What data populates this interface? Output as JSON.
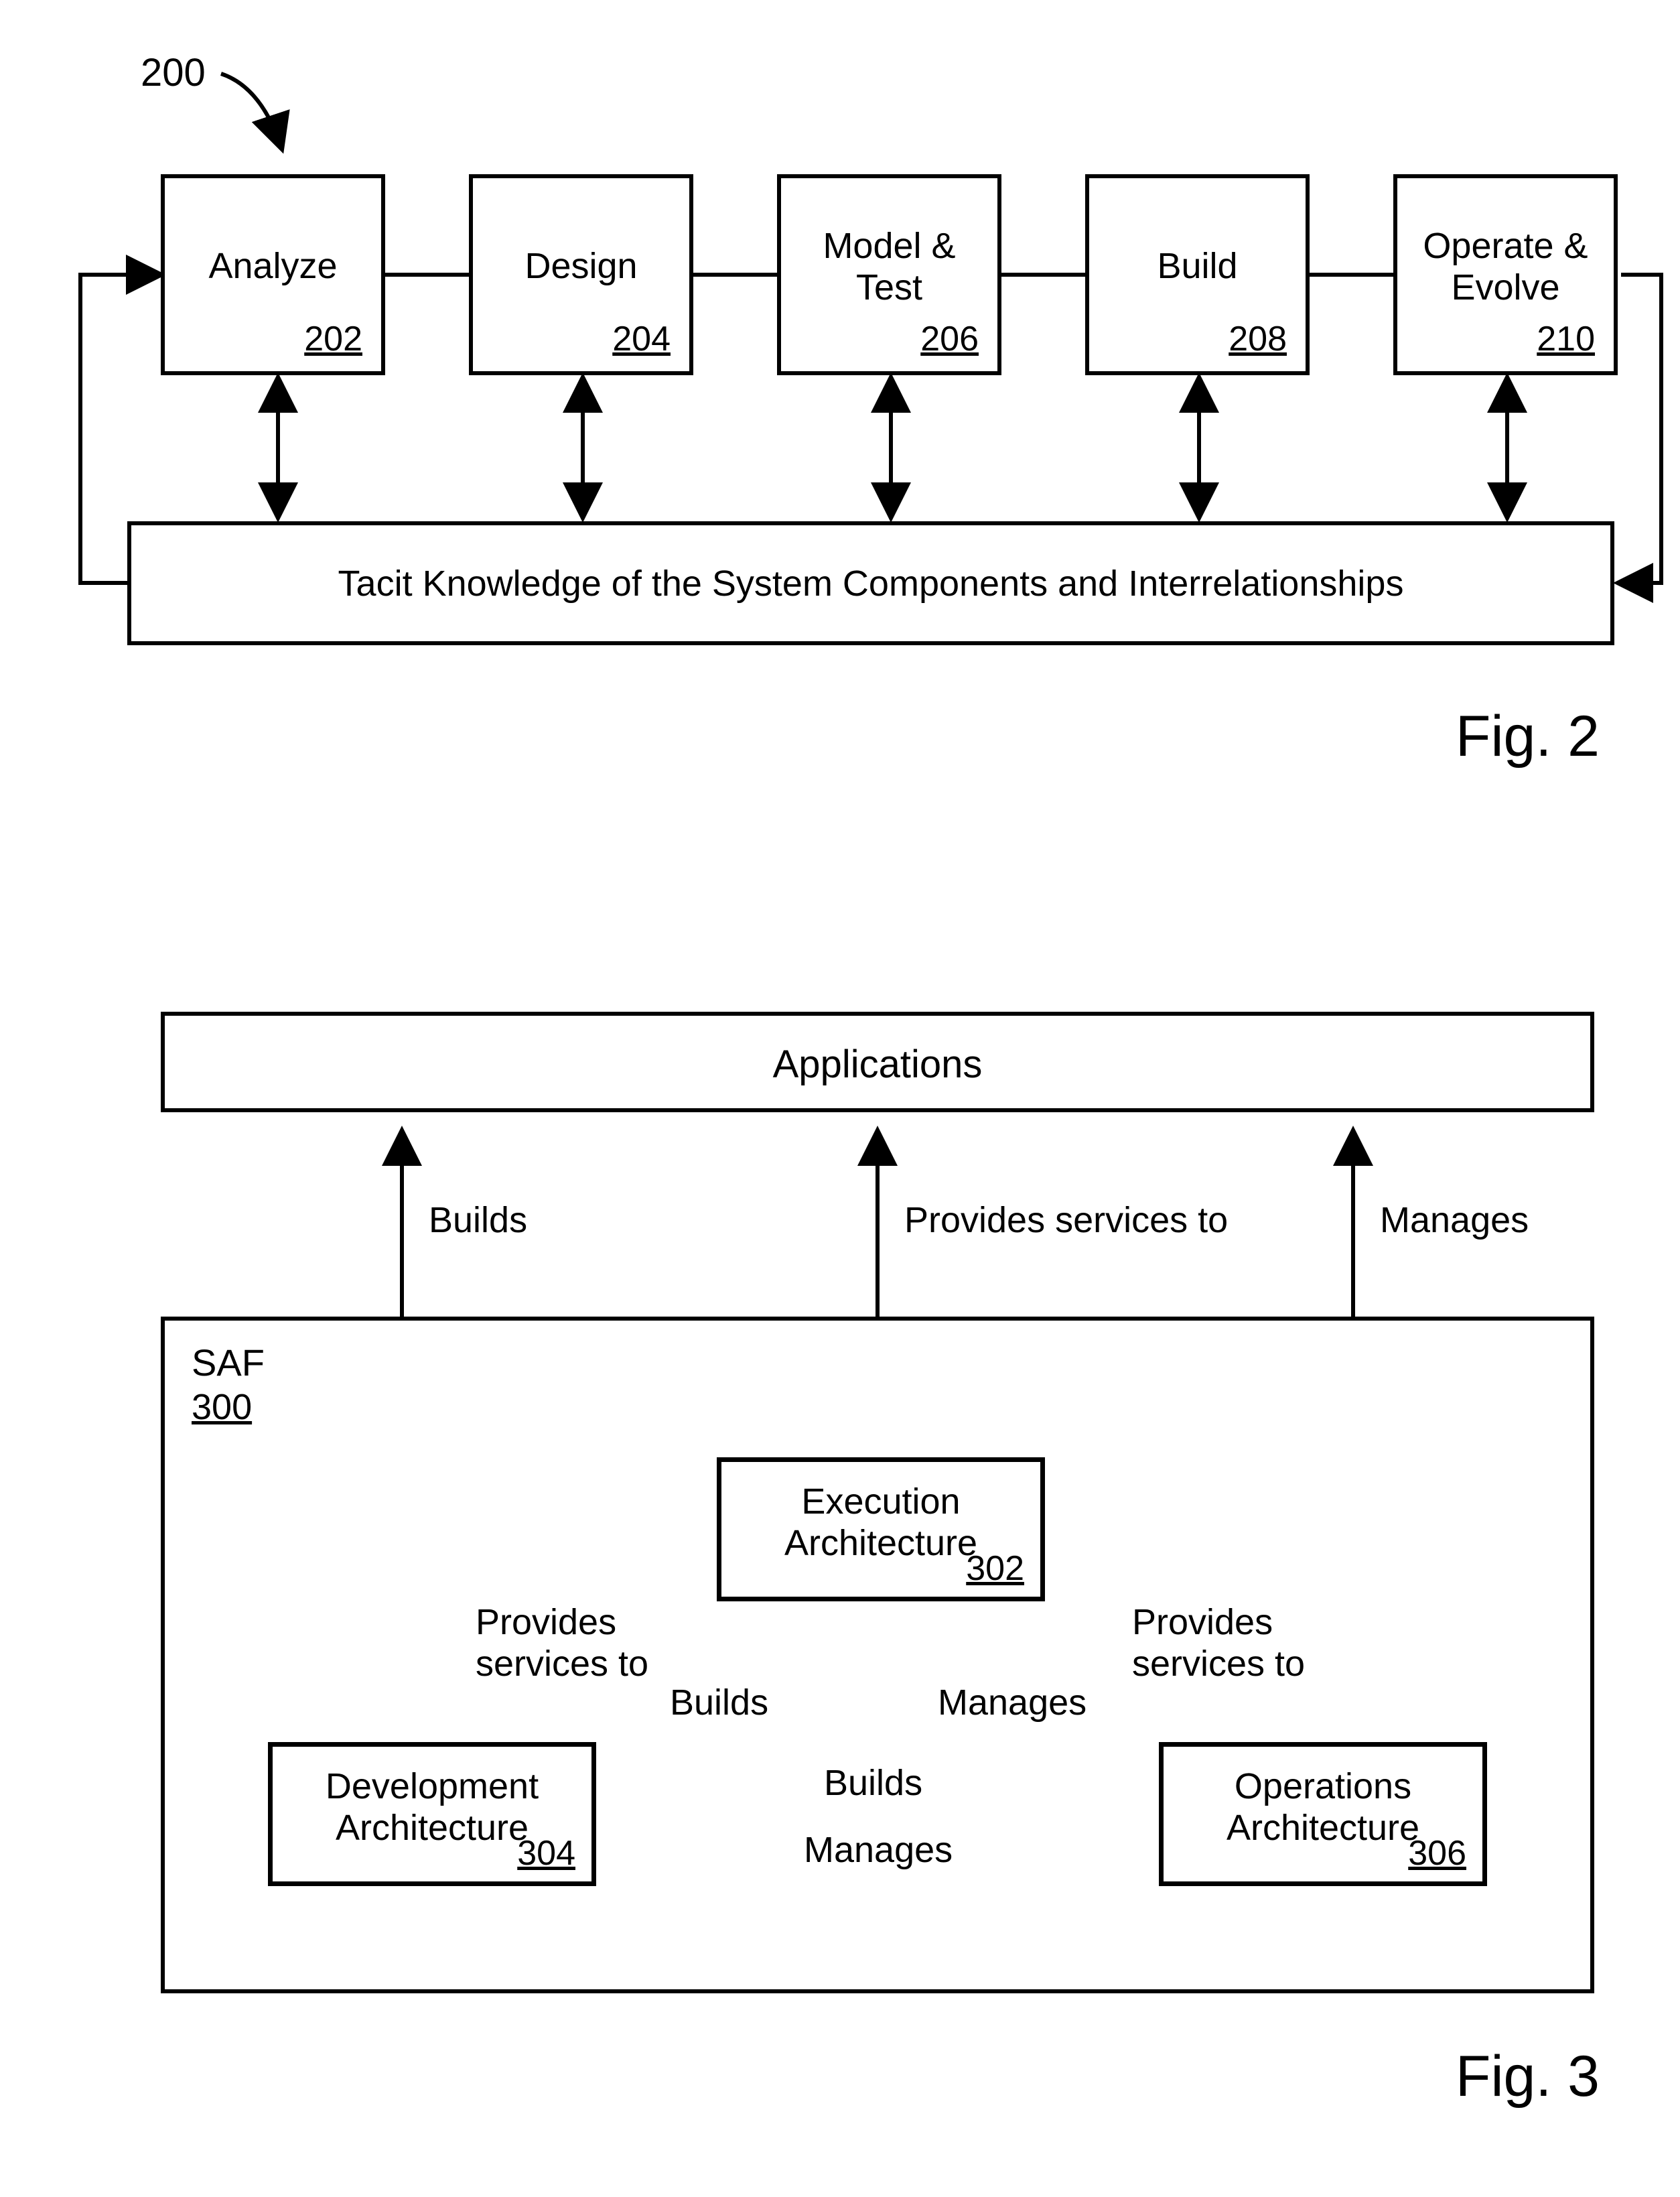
{
  "fig2": {
    "ref": "200",
    "caption": "Fig. 2",
    "boxes": [
      {
        "label": "Analyze",
        "ref": "202"
      },
      {
        "label": "Design",
        "ref": "204"
      },
      {
        "label": "Model &\nTest",
        "ref": "206"
      },
      {
        "label": "Build",
        "ref": "208"
      },
      {
        "label": "Operate &\nEvolve",
        "ref": "210"
      }
    ],
    "bottom": "Tacit Knowledge of the System Components and Interrelationships"
  },
  "fig3": {
    "caption": "Fig. 3",
    "topBox": "Applications",
    "saf": {
      "title": "SAF",
      "ref": "300",
      "exec": {
        "label": "Execution\nArchitecture",
        "ref": "302"
      },
      "dev": {
        "label": "Development\nArchitecture",
        "ref": "304"
      },
      "ops": {
        "label": "Operations\nArchitecture",
        "ref": "306"
      }
    },
    "edgeLabels": {
      "builds": "Builds",
      "providesServicesTo": "Provides services to",
      "manages": "Manages",
      "providesServicesToML1": "Provides",
      "providesServicesToML2": "services to"
    }
  }
}
